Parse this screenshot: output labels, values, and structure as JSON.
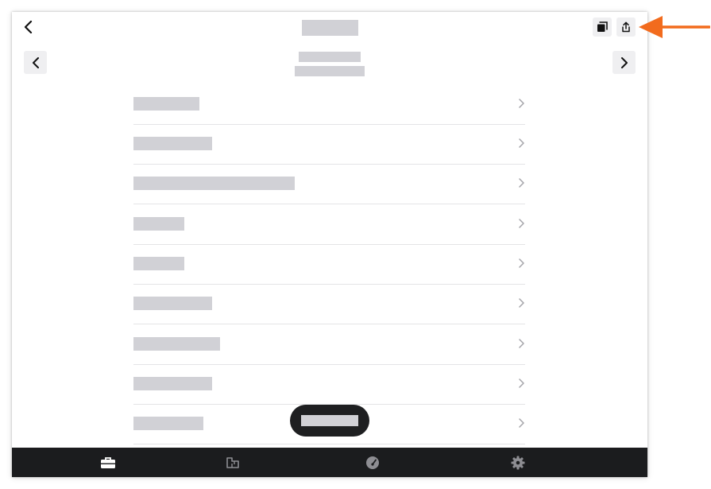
{
  "colors": {
    "accent_arrow": "#F26B1D",
    "tabbar_bg": "#1B1C1E",
    "redaction": "#D1D1D6",
    "button_bg": "#EFEFF1",
    "chevron": "#A5A5AA",
    "divider": "#E4E4E6"
  },
  "header": {
    "back_icon": "chevron-left-icon",
    "title": "",
    "actions": [
      "copy-icon",
      "share-icon"
    ]
  },
  "pager": {
    "prev_icon": "chevron-left-icon",
    "next_icon": "chevron-right-icon",
    "title": "",
    "subtitle": ""
  },
  "list": {
    "items": [
      {
        "label": ""
      },
      {
        "label": ""
      },
      {
        "label": ""
      },
      {
        "label": ""
      },
      {
        "label": ""
      },
      {
        "label": ""
      },
      {
        "label": ""
      },
      {
        "label": ""
      },
      {
        "label": ""
      }
    ]
  },
  "toast": {
    "text": ""
  },
  "tabbar": {
    "tabs": [
      {
        "icon": "toolbox-icon",
        "active": true
      },
      {
        "icon": "floorplan-icon",
        "active": false
      },
      {
        "icon": "dashboard-gauge-icon",
        "active": false
      },
      {
        "icon": "gear-icon",
        "active": false
      }
    ]
  },
  "annotation": {
    "icon": "arrow-left-icon",
    "target": "share-icon"
  }
}
